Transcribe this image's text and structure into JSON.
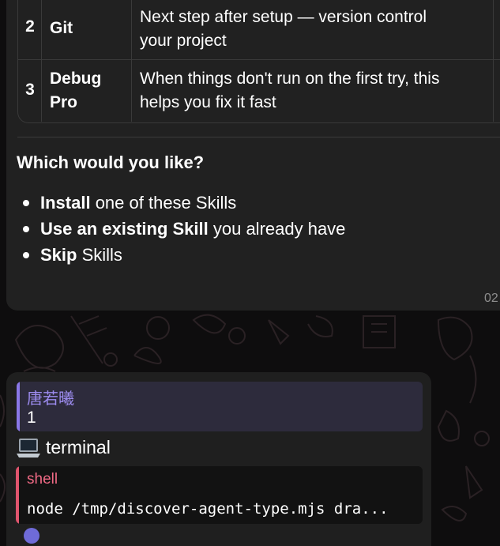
{
  "table": {
    "rows": [
      {
        "num": "2",
        "name": [
          "Git"
        ],
        "desc": [
          "Next step after setup — version control",
          "your project"
        ]
      },
      {
        "num": "3",
        "name": [
          "Debug",
          "Pro"
        ],
        "desc": [
          "When things don't run on the first try, this",
          "helps you fix it fast"
        ]
      }
    ]
  },
  "message": {
    "question": "Which would you like?",
    "options": [
      {
        "bold": "Install",
        "rest": " one of these Skills"
      },
      {
        "bold": "Use an existing Skill",
        "rest": " you already have"
      },
      {
        "bold": "Skip",
        "rest": " Skills"
      }
    ],
    "time_partial": "02"
  },
  "reply": {
    "author": "唐若曦",
    "text": "1"
  },
  "tool": {
    "icon": "laptop-icon",
    "label": "terminal",
    "code_lang": "shell",
    "code": "node /tmp/discover-agent-type.mjs dra..."
  },
  "colors": {
    "bubble": "#212121",
    "reply_accent": "#8a78e8",
    "code_accent": "#e0556e",
    "background": "#0e0d0e"
  }
}
